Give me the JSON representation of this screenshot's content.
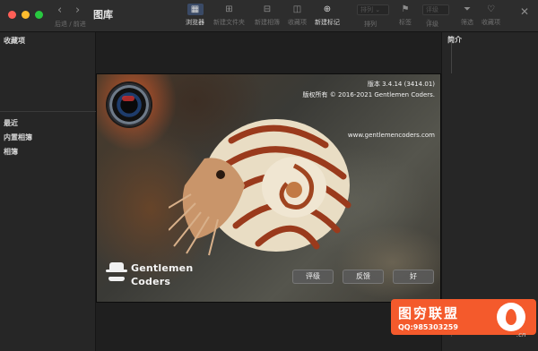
{
  "window": {
    "title": "图库",
    "nav_label": "后退 / 前进"
  },
  "toolbar": {
    "buttons": [
      {
        "label": "浏览器",
        "icon": "browser-icon"
      },
      {
        "label": "新建文件夹",
        "icon": "new-folder-icon"
      },
      {
        "label": "新建相簿",
        "icon": "new-album-icon"
      },
      {
        "label": "收藏项",
        "icon": "favorites-icon"
      },
      {
        "label": "新建标记",
        "icon": "new-tag-icon"
      },
      {
        "label": "排列",
        "icon": "sort-icon"
      },
      {
        "label": "标签",
        "icon": "flag-icon"
      },
      {
        "label": "评级",
        "icon": "rating-icon"
      },
      {
        "label": "筛选",
        "icon": "filter-icon"
      },
      {
        "label": "收藏项",
        "icon": "heart-icon"
      }
    ],
    "sort_select": "排列",
    "rating_select": "评级"
  },
  "sidebar": {
    "favorites": "收藏项",
    "recent": "最近",
    "builtin_albums": "内置相簿",
    "albums": "相簿"
  },
  "info_panel": {
    "title": "简介"
  },
  "about": {
    "version": "版本 3.4.14 (3414.01)",
    "copyright": "版权所有 © 2016-2021 Gentlemen Coders.",
    "website": "www.gentlemencoders.com",
    "brand_line1": "Gentlemen",
    "brand_line2": "Coders",
    "rate_button": "评级",
    "feedback_button": "反馈",
    "ok_button": "好"
  },
  "watermark": {
    "name": "图穷联盟",
    "qq": "QQ:985303259",
    "suffix": ".cn"
  },
  "colors": {
    "accent": "#3a4a66",
    "watermark": "#f45a2c"
  }
}
